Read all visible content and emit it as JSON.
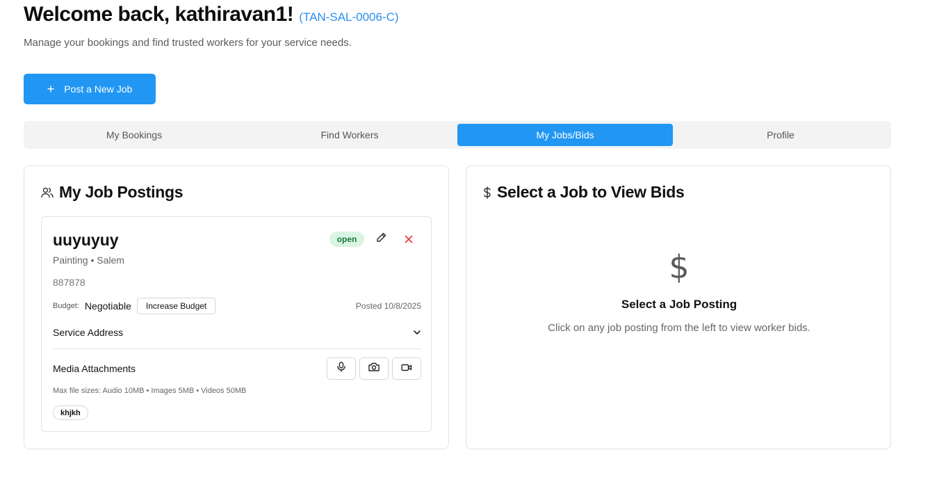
{
  "header": {
    "welcome": "Welcome back, kathiravan1!",
    "user_code": "(TAN-SAL-0006-C)",
    "subtitle": "Manage your bookings and find trusted workers for your service needs."
  },
  "post_button": {
    "icon": "plus-icon",
    "label": "Post a New Job"
  },
  "tabs": [
    {
      "label": "My Bookings",
      "active": false
    },
    {
      "label": "Find Workers",
      "active": false
    },
    {
      "label": "My Jobs/Bids",
      "active": true
    },
    {
      "label": "Profile",
      "active": false
    }
  ],
  "postings": {
    "icon": "users-icon",
    "title": "My Job Postings",
    "job": {
      "title": "uuyuyuy",
      "meta": "Painting • Salem",
      "description": "887878",
      "status": "open",
      "budget_label": "Budget:",
      "budget_value": "Negotiable",
      "increase_label": "Increase Budget",
      "posted": "Posted 10/8/2025",
      "address_label": "Service Address",
      "media_label": "Media Attachments",
      "file_sizes": "Max file sizes: Audio 10MB • Images 5MB • Videos 50MB",
      "tag": "khjkh"
    }
  },
  "bids": {
    "icon": "dollar-icon",
    "title": "Select a Job to View Bids",
    "empty_icon": "$",
    "empty_title": "Select a Job Posting",
    "empty_subtitle": "Click on any job posting from the left to view worker bids."
  },
  "colors": {
    "accent": "#2196f3",
    "status_open_bg": "#d9f4e2",
    "status_open_text": "#1b7a3a",
    "delete": "#e53935"
  }
}
